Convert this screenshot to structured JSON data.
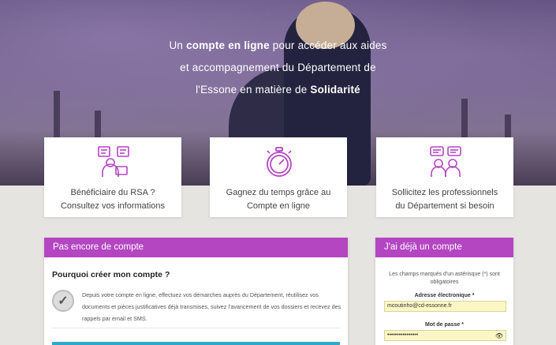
{
  "hero": {
    "line1_pre": "Un ",
    "line1_bold": "compte en ligne",
    "line1_post": " pour accéder aux aides",
    "line2": "et accompagnement du Département de",
    "line3_pre": "l'Essone en matière de ",
    "line3_bold": "Solidarité"
  },
  "cards": [
    {
      "icon": "rsa-beneficiary-icon",
      "line1": "Bénéficiaire du RSA ?",
      "line2": "Consultez vos informations"
    },
    {
      "icon": "stopwatch-icon",
      "line1": "Gagnez du temps grâce au",
      "line2": "Compte en ligne"
    },
    {
      "icon": "professionals-chat-icon",
      "line1": "Sollicitez les professionnels",
      "line2": "du Département si besoin"
    }
  ],
  "no_account": {
    "header": "Pas encore de compte",
    "why_title": "Pourquoi créer mon compte ?",
    "why_text": "Depuis votre compte en ligne, effectuez vos démarches auprès du Département, réutilisez vos documents et pièces justificatives déjà transmises, suivez l'avancement de vos dossiers et recevez des rappels par email et SMS."
  },
  "login": {
    "header": "J'ai déjà un compte",
    "required_note": "Les champs marqués d'un astérisque (*) sont obligatoires",
    "email_label": "Adresse électronique *",
    "email_value": "mcoutinho@cd-essonne.fr",
    "password_label": "Mot de passe *",
    "password_value": "••••••••••••••••"
  },
  "colors": {
    "accent": "#b446c2",
    "button": "#2ea8c8",
    "field_bg": "#fbf7c4"
  }
}
